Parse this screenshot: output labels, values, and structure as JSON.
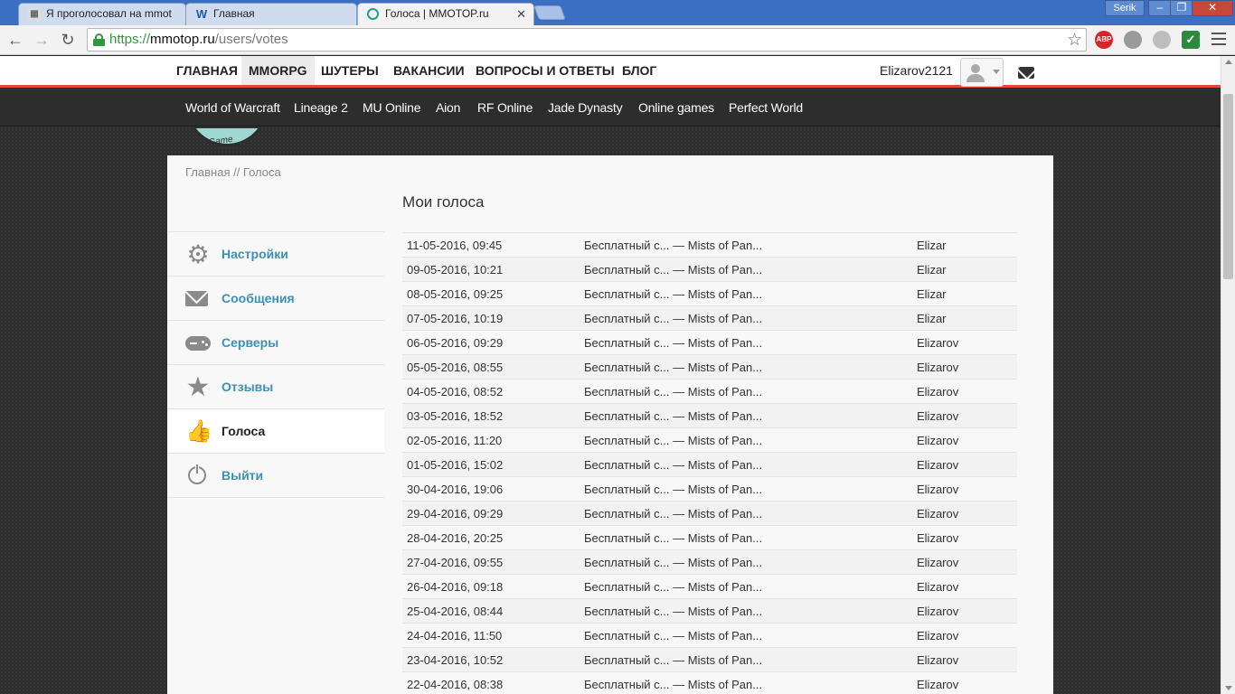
{
  "browser": {
    "tabs": [
      {
        "title": "Я проголосовал на mmot",
        "icon": "generic-page-icon",
        "active": false
      },
      {
        "title": "Главная",
        "icon": "w-site-icon",
        "active": false
      },
      {
        "title": "Голоса | MMOTOP.ru",
        "icon": "mmotop-icon",
        "active": true
      }
    ],
    "window_user": "Serik",
    "window_buttons": {
      "minimize": "–",
      "restore": "❐",
      "close": "✕"
    },
    "url": {
      "scheme": "https://",
      "host": "mmotop.ru",
      "path": "/users/votes"
    },
    "extensions": [
      {
        "name": "adblock-icon",
        "label": "ABP",
        "color": "#d8232a"
      },
      {
        "name": "extension-gray-icon",
        "label": "",
        "color": "#9a9a9a"
      },
      {
        "name": "extension-circle-icon",
        "label": "",
        "color": "#bdbdbd"
      },
      {
        "name": "extension-check-icon",
        "label": "✓",
        "color": "#2b8a3e"
      }
    ]
  },
  "topnav": {
    "items": [
      "ГЛАВНАЯ",
      "MMORPG",
      "ШУТЕРЫ",
      "ВАКАНСИИ",
      "ВОПРОСЫ И ОТВЕТЫ",
      "БЛОГ"
    ],
    "active_index": 1,
    "username": "Elizarov2121"
  },
  "gamenav": {
    "items": [
      "World of Warcraft",
      "Lineage 2",
      "MU Online",
      "Aion",
      "RF Online",
      "Jade Dynasty",
      "Online games",
      "Perfect World"
    ]
  },
  "logo": {
    "fragment_text": "Game Controller"
  },
  "breadcrumb": "Главная // Голоса",
  "page_title": "Мои голоса",
  "sidemenu": {
    "items": [
      {
        "label": "Настройки",
        "icon": "gear-icon"
      },
      {
        "label": "Сообщения",
        "icon": "mail-icon"
      },
      {
        "label": "Серверы",
        "icon": "gamepad-icon"
      },
      {
        "label": "Отзывы",
        "icon": "star-icon"
      },
      {
        "label": "Голоса",
        "icon": "thumbs-up-icon",
        "active": true
      },
      {
        "label": "Выйти",
        "icon": "power-icon"
      }
    ]
  },
  "votes": {
    "rows": [
      {
        "date": "11-05-2016, 09:45",
        "server": "Бесплатный с... — Mists of Pan...",
        "nick": "Elizar"
      },
      {
        "date": "09-05-2016, 10:21",
        "server": "Бесплатный с... — Mists of Pan...",
        "nick": "Elizar"
      },
      {
        "date": "08-05-2016, 09:25",
        "server": "Бесплатный с... — Mists of Pan...",
        "nick": "Elizar"
      },
      {
        "date": "07-05-2016, 10:19",
        "server": "Бесплатный с... — Mists of Pan...",
        "nick": "Elizar"
      },
      {
        "date": "06-05-2016, 09:29",
        "server": "Бесплатный с... — Mists of Pan...",
        "nick": "Elizarov"
      },
      {
        "date": "05-05-2016, 08:55",
        "server": "Бесплатный с... — Mists of Pan...",
        "nick": "Elizarov"
      },
      {
        "date": "04-05-2016, 08:52",
        "server": "Бесплатный с... — Mists of Pan...",
        "nick": "Elizarov"
      },
      {
        "date": "03-05-2016, 18:52",
        "server": "Бесплатный с... — Mists of Pan...",
        "nick": "Elizarov"
      },
      {
        "date": "02-05-2016, 11:20",
        "server": "Бесплатный с... — Mists of Pan...",
        "nick": "Elizarov"
      },
      {
        "date": "01-05-2016, 15:02",
        "server": "Бесплатный с... — Mists of Pan...",
        "nick": "Elizarov"
      },
      {
        "date": "30-04-2016, 19:06",
        "server": "Бесплатный с... — Mists of Pan...",
        "nick": "Elizarov"
      },
      {
        "date": "29-04-2016, 09:29",
        "server": "Бесплатный с... — Mists of Pan...",
        "nick": "Elizarov"
      },
      {
        "date": "28-04-2016, 20:25",
        "server": "Бесплатный с... — Mists of Pan...",
        "nick": "Elizarov"
      },
      {
        "date": "27-04-2016, 09:55",
        "server": "Бесплатный с... — Mists of Pan...",
        "nick": "Elizarov"
      },
      {
        "date": "26-04-2016, 09:18",
        "server": "Бесплатный с... — Mists of Pan...",
        "nick": "Elizarov"
      },
      {
        "date": "25-04-2016, 08:44",
        "server": "Бесплатный с... — Mists of Pan...",
        "nick": "Elizarov"
      },
      {
        "date": "24-04-2016, 11:50",
        "server": "Бесплатный с... — Mists of Pan...",
        "nick": "Elizarov"
      },
      {
        "date": "23-04-2016, 10:52",
        "server": "Бесплатный с... — Mists of Pan...",
        "nick": "Elizarov"
      },
      {
        "date": "22-04-2016, 08:38",
        "server": "Бесплатный с... — Mists of Pan...",
        "nick": "Elizarov"
      }
    ]
  },
  "colors": {
    "accent_red": "#e2483b",
    "link_blue": "#3e90b5",
    "nav_dark": "#2d2d2d"
  }
}
